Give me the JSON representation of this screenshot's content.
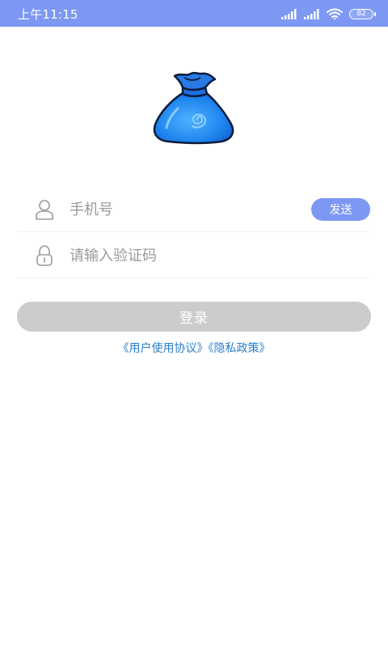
{
  "status_bar": {
    "time": "上午11:15",
    "battery_level": "82",
    "background_color": "#7d98f3",
    "icons": [
      "signal-icon",
      "signal-icon",
      "wifi-icon",
      "battery-icon"
    ]
  },
  "logo": {
    "icon": "money-bag-icon",
    "color": "#2e8cf0"
  },
  "form": {
    "phone_placeholder": "手机号",
    "phone_icon": "user-icon",
    "send_label": "发送",
    "code_placeholder": "请输入验证码",
    "code_icon": "lock-icon",
    "login_label": "登录",
    "accent_color": "#7d98f3",
    "login_disabled_color": "#cccccc"
  },
  "agreement": {
    "user_agreement": "《用户使用协议》",
    "privacy_policy": "《隐私政策》",
    "link_color": "#2a7ec8"
  }
}
